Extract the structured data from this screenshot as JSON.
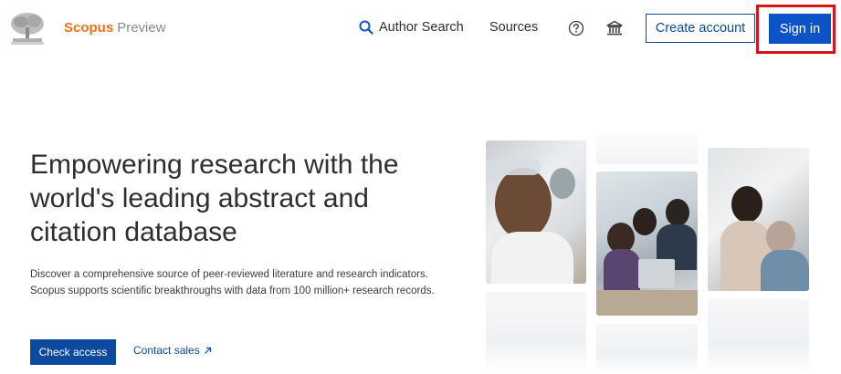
{
  "header": {
    "brand_name": "Scopus",
    "brand_suffix": "Preview",
    "nav": {
      "author_search": "Author Search",
      "sources": "Sources"
    },
    "create_account": "Create account",
    "sign_in": "Sign in"
  },
  "hero": {
    "title": "Empowering research with the world's leading abstract and citation database",
    "description": "Discover a comprehensive source of peer-reviewed literature and research indicators. Scopus supports scientific breakthroughs with data from 100 million+ research records.",
    "check_access": "Check access",
    "contact_sales": "Contact sales"
  },
  "colors": {
    "brand_orange": "#e9711c",
    "primary_blue": "#0d53c8",
    "highlight_red": "#d9141c"
  },
  "icons": [
    "elsevier-tree-logo",
    "search-icon",
    "help-circle-icon",
    "institution-icon",
    "external-arrow-icon"
  ]
}
